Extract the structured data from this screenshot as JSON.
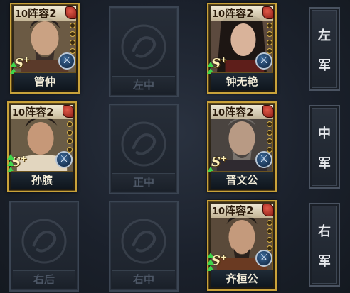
{
  "card_header": {
    "level": "10",
    "label": "阵容2"
  },
  "grade": {
    "letter": "S",
    "plus": "+"
  },
  "skill_icon": "crossed-swords-icon",
  "heroes": [
    {
      "name": "管仲",
      "row": 1,
      "col": 1,
      "upgrade_arrows": 2
    },
    {
      "name": "钟无艳",
      "row": 1,
      "col": 3,
      "upgrade_arrows": 2
    },
    {
      "name": "孙膑",
      "row": 2,
      "col": 1,
      "upgrade_arrows": 3
    },
    {
      "name": "晋文公",
      "row": 2,
      "col": 3,
      "upgrade_arrows": 1
    },
    {
      "name": "齐桓公",
      "row": 3,
      "col": 3,
      "upgrade_arrows": 3
    }
  ],
  "empty_slots": [
    {
      "label": "左中"
    },
    {
      "label": "正中"
    },
    {
      "label": "右后"
    },
    {
      "label": "右中"
    }
  ],
  "armies": [
    {
      "char1": "左",
      "char2": "军"
    },
    {
      "char1": "中",
      "char2": "军"
    },
    {
      "char1": "右",
      "char2": "军"
    }
  ],
  "colors": {
    "frame_gold": "#c9a23a",
    "arrow_green": "#3fd64a",
    "empty_text": "#4d5766"
  }
}
